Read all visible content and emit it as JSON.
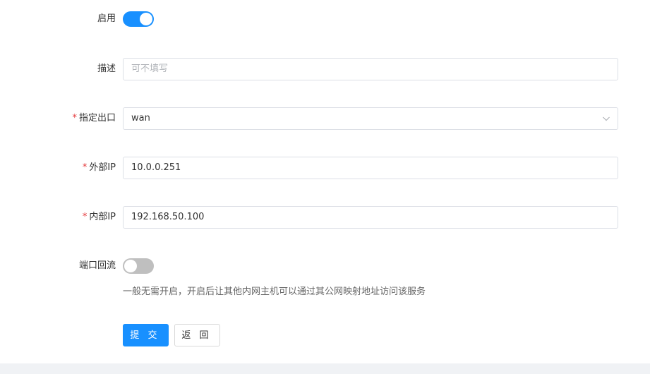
{
  "form": {
    "enable": {
      "label": "启用",
      "state": "on"
    },
    "description": {
      "label": "描述",
      "placeholder": "可不填写",
      "value": ""
    },
    "outbound": {
      "required_mark": "*",
      "label": "指定出口",
      "value": "wan"
    },
    "external_ip": {
      "required_mark": "*",
      "label": "外部IP",
      "value": "10.0.0.251"
    },
    "internal_ip": {
      "required_mark": "*",
      "label": "内部IP",
      "value": "192.168.50.100"
    },
    "port_loopback": {
      "label": "端口回流",
      "state": "off",
      "hint": "一般无需开启，开启后让其他内网主机可以通过其公网映射地址访问该服务"
    }
  },
  "actions": {
    "submit_label": "提 交",
    "back_label": "返 回"
  },
  "colors": {
    "accent": "#1890ff",
    "required": "#e4393c",
    "toggle_off": "#bfbfbf"
  },
  "icons": {
    "select_arrow": "chevron-down-icon"
  }
}
